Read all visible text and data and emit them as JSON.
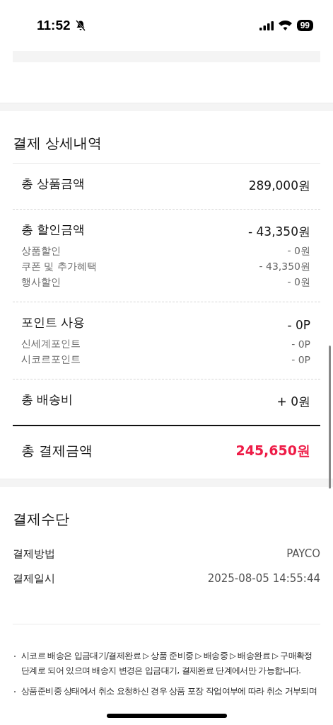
{
  "status_bar": {
    "time": "11:52",
    "battery": "99"
  },
  "payment_details": {
    "title": "결제 상세내역",
    "groups": [
      {
        "items": [
          {
            "kind": "main",
            "label": "총 상품금액",
            "value": "289,000원"
          }
        ]
      },
      {
        "items": [
          {
            "kind": "main",
            "label": "총 할인금액",
            "value": "- 43,350원"
          },
          {
            "kind": "sub",
            "label": "상품할인",
            "value": "- 0원"
          },
          {
            "kind": "sub",
            "label": "쿠폰 및 추가혜택",
            "value": "- 43,350원"
          },
          {
            "kind": "sub",
            "label": "행사할인",
            "value": "- 0원"
          }
        ]
      },
      {
        "items": [
          {
            "kind": "main",
            "label": "포인트 사용",
            "value": "- 0P"
          },
          {
            "kind": "sub",
            "label": "신세계포인트",
            "value": "- 0P"
          },
          {
            "kind": "sub",
            "label": "시코르포인트",
            "value": "- 0P"
          }
        ]
      },
      {
        "items": [
          {
            "kind": "main",
            "label": "총 배송비",
            "value": "+ 0원"
          }
        ]
      }
    ],
    "total": {
      "label": "총 결제금액",
      "value": "245,650원"
    }
  },
  "payment_method": {
    "title": "결제수단",
    "rows": [
      {
        "label": "결제방법",
        "value": "PAYCO"
      },
      {
        "label": "결제일시",
        "value": "2025-08-05 14:55:44"
      }
    ]
  },
  "notes": [
    "시코르 배송은 입금대기/결제완료 ▷ 상품 준비중 ▷ 배송중 ▷ 배송완료 ▷ 구매확정 단계로 되어 있으며 배송지 변경은 입금대기, 결제완료 단계에서만 가능합니다.",
    "상품준비중 상태에서 취소 요청하신 경우 상품 포장 작업여부에 따라 취소 거부되며"
  ]
}
